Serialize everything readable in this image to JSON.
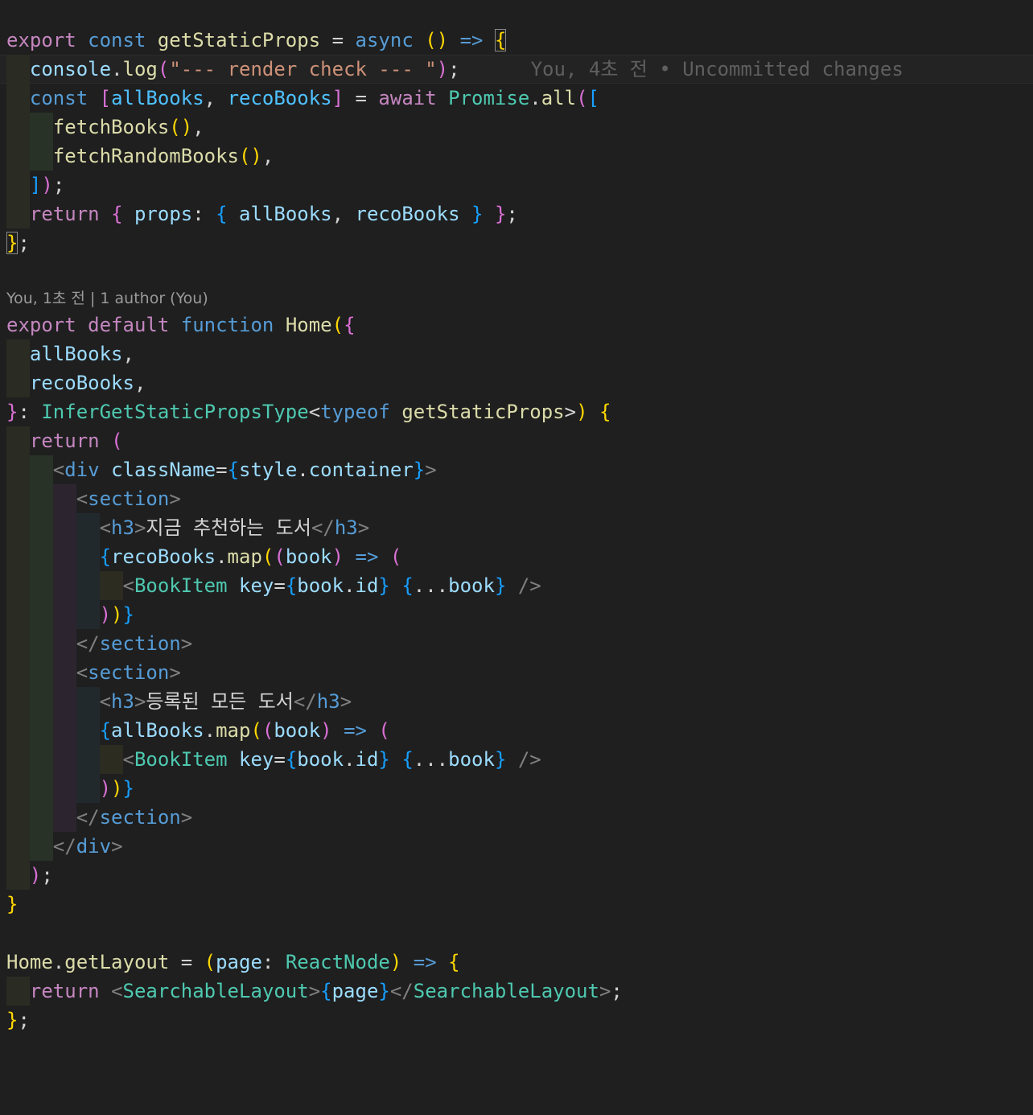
{
  "editor": {
    "inline_blame": "You, 4초 전 • Uncommitted changes",
    "codelens": "You, 1초 전 | 1 author (You)",
    "tokens": {
      "export": "export",
      "const": "const",
      "default": "default",
      "function": "function",
      "async": "async",
      "await": "await",
      "return": "return",
      "typeof": "typeof",
      "getStaticProps": "getStaticProps",
      "console": "console",
      "log": "log",
      "log_string": "\"--- render check --- \"",
      "allBooks": "allBooks",
      "recoBooks": "recoBooks",
      "Promise": "Promise",
      "all": "all",
      "fetchBooks": "fetchBooks",
      "fetchRandomBooks": "fetchRandomBooks",
      "props": "props",
      "Home": "Home",
      "InferGetStaticPropsType": "InferGetStaticPropsType",
      "div": "div",
      "className": "className",
      "style": "style",
      "container": "container",
      "section": "section",
      "h3": "h3",
      "heading_recommended": "지금 추천하는 도서",
      "heading_all": "등록된 모든 도서",
      "map": "map",
      "book": "book",
      "BookItem": "BookItem",
      "key": "key",
      "id": "id",
      "getLayout": "getLayout",
      "page": "page",
      "ReactNode": "ReactNode",
      "SearchableLayout": "SearchableLayout"
    }
  }
}
